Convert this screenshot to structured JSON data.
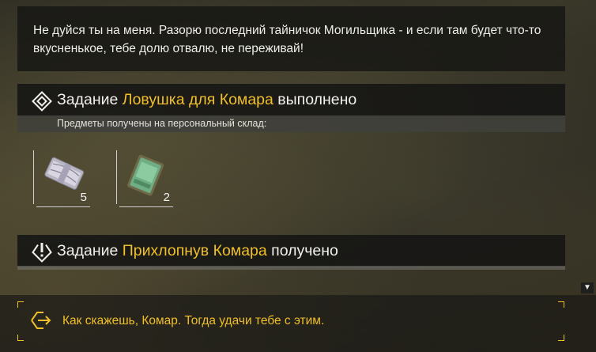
{
  "dialog": {
    "text": "Не дуйся ты на меня. Разорю последний тайничок Могильщика - и если там будет что-то вкусненькое, тебе долю отвалю, не переживай!"
  },
  "quest_completed": {
    "prefix": "Задание ",
    "name": "Ловушка для Комара",
    "suffix": " выполнено",
    "items_label": "Предметы получены на персональный склад:",
    "items": [
      {
        "icon": "money-bundle-icon",
        "count": "5"
      },
      {
        "icon": "green-package-icon",
        "count": "2"
      }
    ]
  },
  "quest_received": {
    "prefix": "Задание ",
    "name": "Прихлопнув Комара",
    "suffix": " получено"
  },
  "choice": {
    "text": "Как скажешь, Комар. Тогда удачи тебе с этим."
  },
  "colors": {
    "accent": "#f0bf2a",
    "text": "#f0eee8",
    "panel": "#161614"
  }
}
